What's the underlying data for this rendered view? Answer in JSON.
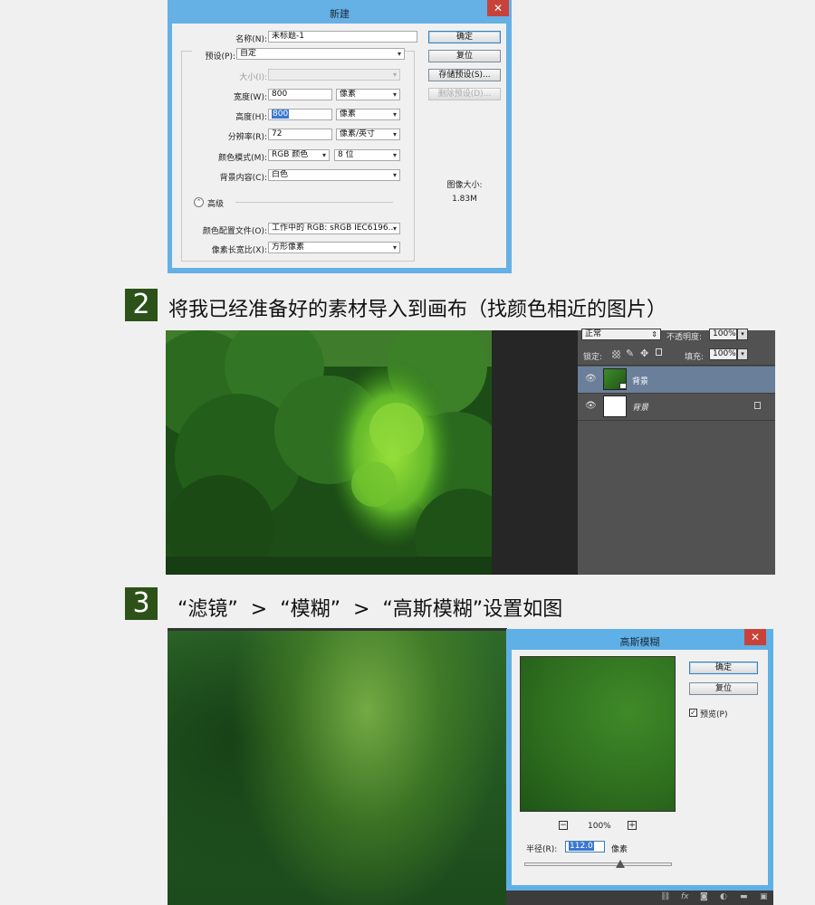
{
  "new_dialog": {
    "title": "新建",
    "close": "✕",
    "name_label": "名称(N):",
    "name_value": "未标题-1",
    "preset_label": "预设(P):",
    "preset_value": "自定",
    "size_label": "大小(I):",
    "width_label": "宽度(W):",
    "width_value": "800",
    "width_unit": "像素",
    "height_label": "高度(H):",
    "height_value": "800",
    "height_unit": "像素",
    "resolution_label": "分辨率(R):",
    "resolution_value": "72",
    "resolution_unit": "像素/英寸",
    "color_mode_label": "颜色模式(M):",
    "color_mode_value": "RGB 颜色",
    "bit_depth_value": "8 位",
    "background_label": "背景内容(C):",
    "background_value": "白色",
    "advanced_label": "高级",
    "color_profile_label": "颜色配置文件(O):",
    "color_profile_value": "工作中的 RGB: sRGB IEC6196...",
    "pixel_aspect_label": "像素长宽比(X):",
    "pixel_aspect_value": "方形像素",
    "buttons": {
      "ok": "确定",
      "reset": "复位",
      "save_preset": "存储预设(S)...",
      "delete_preset": "删除预设(D)..."
    },
    "image_size_label": "图像大小:",
    "image_size_value": "1.83M"
  },
  "step2": {
    "number": "2",
    "text": "将我已经准备好的素材导入到画布（找颜色相近的图片）"
  },
  "layers_panel": {
    "blend_mode": "正常",
    "opacity_label": "不透明度:",
    "opacity_value": "100%",
    "lock_label": "锁定:",
    "fill_label": "填充:",
    "fill_value": "100%",
    "layers": [
      {
        "name": "背景"
      },
      {
        "name": "背景"
      }
    ]
  },
  "step3": {
    "number": "3",
    "text": "“滤镜”  >  “模糊”  >  “高斯模糊”设置如图"
  },
  "gaussian_dialog": {
    "title": "高斯模糊",
    "close": "✕",
    "ok": "确定",
    "reset": "复位",
    "preview_label": "预览(P)",
    "preview_checked": true,
    "zoom": "100%",
    "zoom_out": "−",
    "zoom_in": "+",
    "radius_label": "半径(R):",
    "radius_value": "112.0",
    "radius_unit": "像素",
    "radius_slider_fraction": 0.65
  },
  "bottom_toolbar": {
    "fx_label": "fx"
  }
}
